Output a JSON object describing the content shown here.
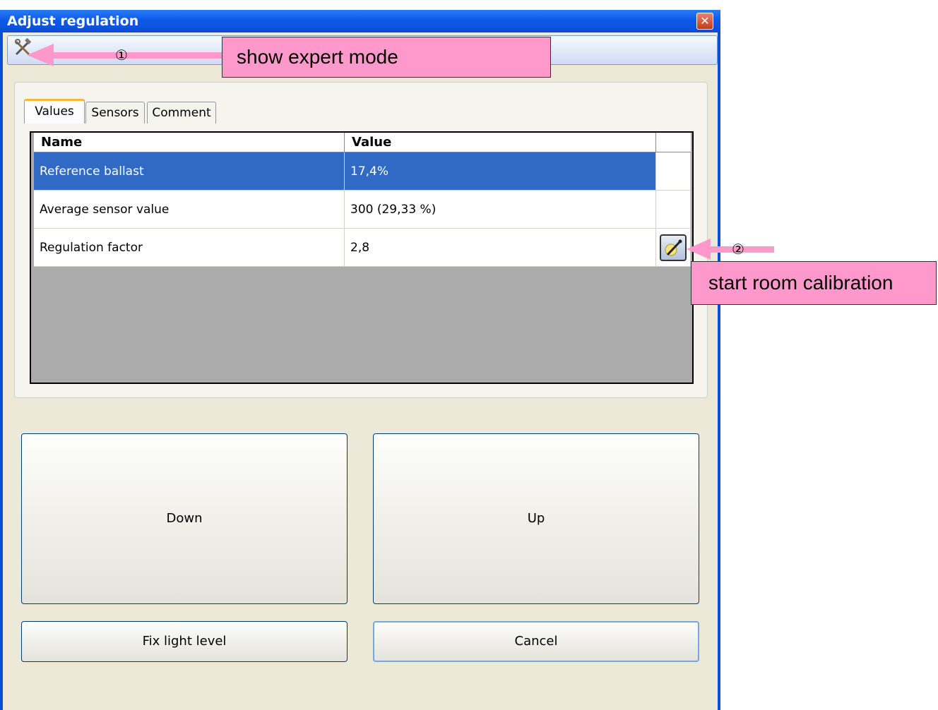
{
  "window": {
    "title": "Adjust regulation",
    "close_label": "✕"
  },
  "toolbar": {
    "expert_icon": "tools-icon"
  },
  "tabs": [
    {
      "label": "Values",
      "active": true
    },
    {
      "label": "Sensors",
      "active": false
    },
    {
      "label": "Comment",
      "active": false
    }
  ],
  "grid": {
    "columns": [
      "Name",
      "Value"
    ],
    "rows": [
      {
        "name": "Reference ballast",
        "value": "17,4%",
        "selected": true
      },
      {
        "name": "Average sensor value",
        "value": "300  (29,33 %)",
        "selected": false
      },
      {
        "name": "Regulation factor",
        "value": "2,8",
        "selected": false
      }
    ],
    "calibrate_icon": "calibration-wand-icon"
  },
  "buttons": {
    "down": "Down",
    "up": "Up",
    "fix_light": "Fix light level",
    "cancel": "Cancel"
  },
  "annotations": {
    "expert_number": "①",
    "expert_label": "show expert mode",
    "calib_number": "②",
    "calib_label": "start room calibration",
    "arrow_color": "#ff99cc"
  }
}
